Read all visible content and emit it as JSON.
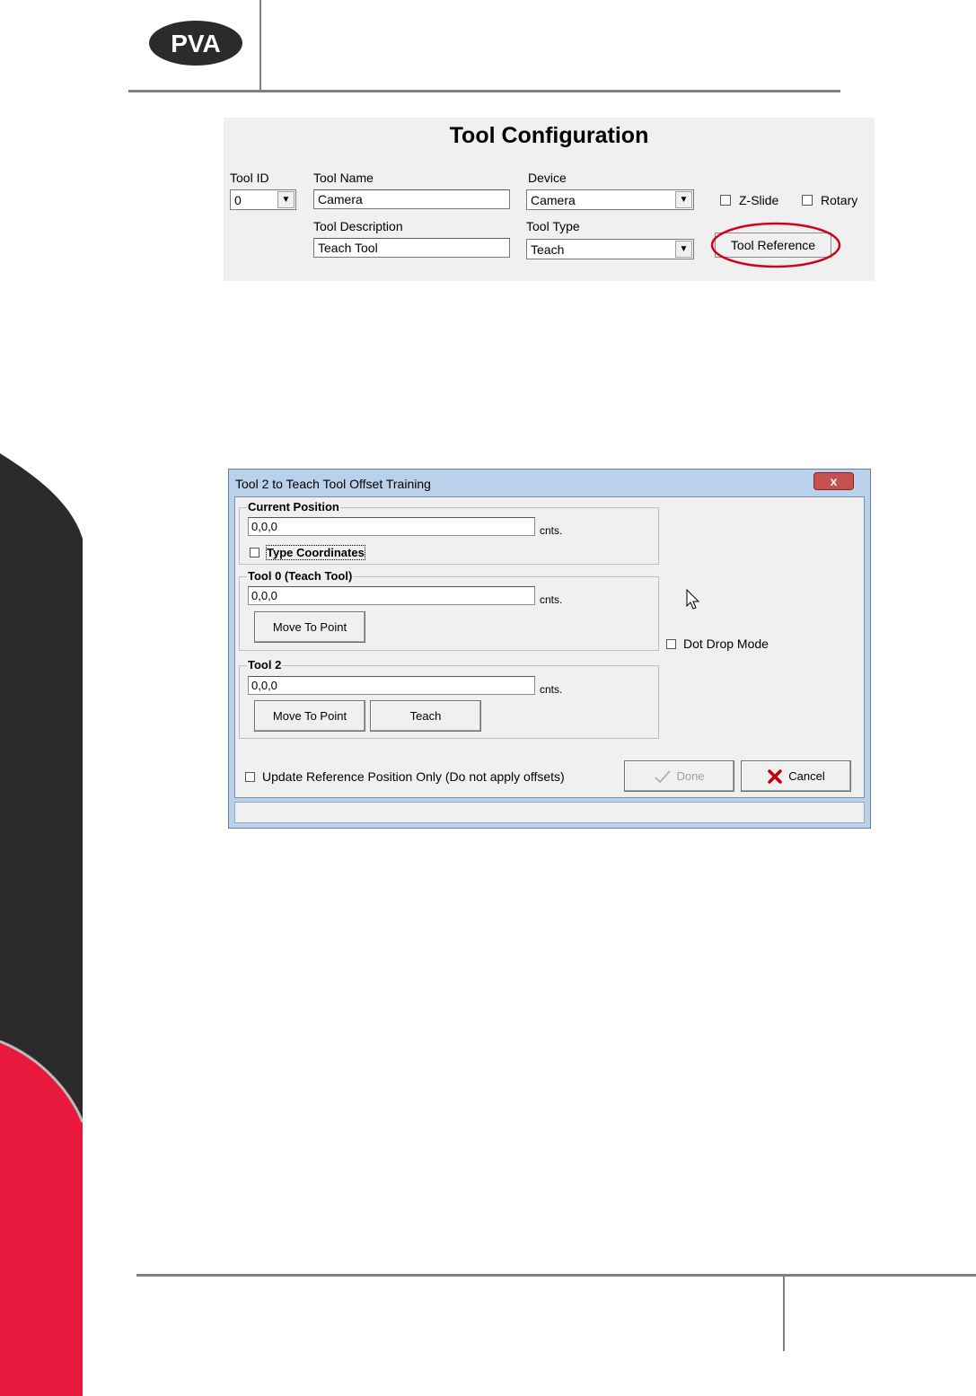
{
  "header": {
    "logo_text": "PVA"
  },
  "tool_config": {
    "title": "Tool Configuration",
    "tool_id_label": "Tool ID",
    "tool_id_value": "0",
    "tool_name_label": "Tool Name",
    "tool_name_value": "Camera",
    "device_label": "Device",
    "device_value": "Camera",
    "z_slide_label": "Z-Slide",
    "rotary_label": "Rotary",
    "tool_description_label": "Tool Description",
    "tool_description_value": "Teach Tool",
    "tool_type_label": "Tool Type",
    "tool_type_value": "Teach",
    "tool_reference_label": "Tool Reference"
  },
  "dialog": {
    "title": "Tool 2 to Teach Tool Offset Training",
    "close_label": "x",
    "current_position": {
      "title": "Current Position",
      "value": "0,0,0",
      "unit": "cnts.",
      "type_coordinates_label": "Type Coordinates"
    },
    "tool0": {
      "title": "Tool 0 (Teach Tool)",
      "value": "0,0,0",
      "unit": "cnts.",
      "move_label": "Move To Point"
    },
    "tool2": {
      "title": "Tool 2",
      "value": "0,0,0",
      "unit": "cnts.",
      "move_label": "Move To Point",
      "teach_label": "Teach"
    },
    "dot_drop_label": "Dot Drop Mode",
    "update_ref_label": "Update Reference Position Only (Do not apply offsets)",
    "done_label": "Done",
    "cancel_label": "Cancel"
  },
  "colors": {
    "brand_dark": "#2b2b2b",
    "brand_red": "#e8193c",
    "annotation_red": "#d0021b"
  }
}
